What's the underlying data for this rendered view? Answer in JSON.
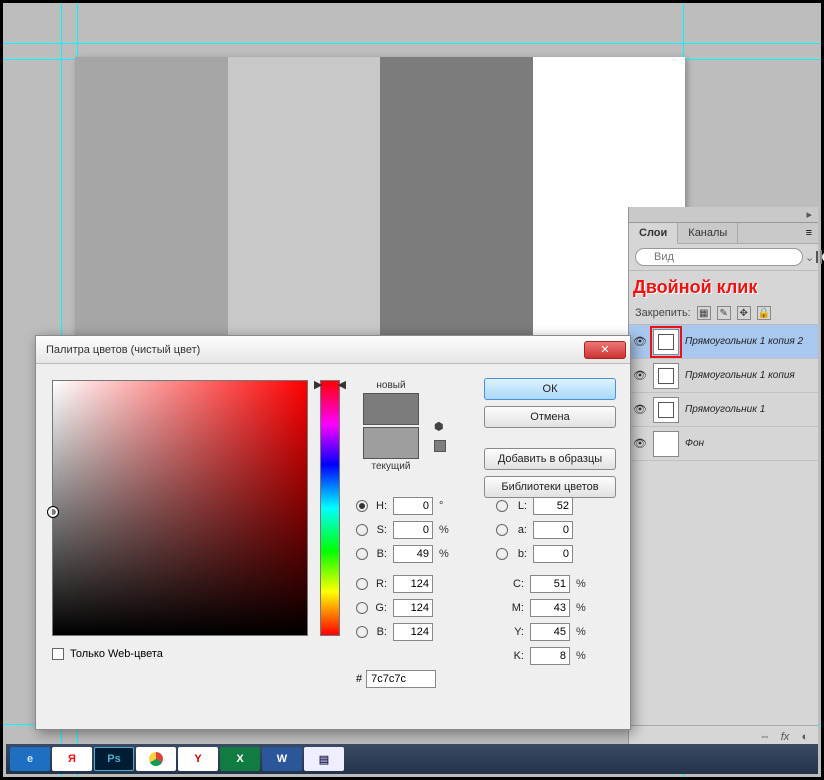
{
  "canvas": {
    "stripes": [
      "#a6a6a6",
      "#c8c8c8",
      "#7c7c7c",
      "#ffffff"
    ]
  },
  "annotation": "Двойной клик",
  "panel": {
    "tabs": {
      "layers": "Слои",
      "channels": "Каналы"
    },
    "filter_placeholder": "Вид",
    "lock_label": "Закрепить:",
    "layers": [
      {
        "name": "Прямоугольник 1 копия 2",
        "selected": true,
        "shape": true,
        "highlight": true
      },
      {
        "name": "Прямоугольник 1 копия",
        "selected": false,
        "shape": true,
        "highlight": false
      },
      {
        "name": "Прямоугольник 1",
        "selected": false,
        "shape": true,
        "highlight": false
      },
      {
        "name": "Фон",
        "selected": false,
        "shape": false,
        "highlight": false
      }
    ],
    "footer_link": "fx"
  },
  "dialog": {
    "title": "Палитра цветов (чистый цвет)",
    "new_label": "новый",
    "current_label": "текущий",
    "swatch_new": "#7c7c7c",
    "swatch_current": "#9e9e9e",
    "buttons": {
      "ok": "ОК",
      "cancel": "Отмена",
      "add": "Добавить в образцы",
      "libs": "Библиотеки цветов"
    },
    "fields": {
      "H": {
        "value": "0",
        "unit": "°",
        "checked": true
      },
      "S": {
        "value": "0",
        "unit": "%",
        "checked": false
      },
      "Bv": {
        "value": "49",
        "unit": "%",
        "checked": false
      },
      "R": {
        "value": "124",
        "unit": "",
        "checked": false
      },
      "G": {
        "value": "124",
        "unit": "",
        "checked": false
      },
      "Bc": {
        "value": "124",
        "unit": "",
        "checked": false
      },
      "L": {
        "value": "52",
        "unit": "",
        "checked": false
      },
      "a": {
        "value": "0",
        "unit": "",
        "checked": false
      },
      "b": {
        "value": "0",
        "unit": "",
        "checked": false
      },
      "C": {
        "value": "51",
        "unit": "%"
      },
      "M": {
        "value": "43",
        "unit": "%"
      },
      "Y": {
        "value": "45",
        "unit": "%"
      },
      "K": {
        "value": "8",
        "unit": "%"
      }
    },
    "hex_label": "#",
    "hex_value": "7c7c7c",
    "web_only_label": "Только Web-цвета"
  },
  "taskbar": {
    "items": [
      "ie",
      "Я",
      "Ps",
      "chrome",
      "Y",
      "X",
      "W",
      "notes"
    ]
  }
}
